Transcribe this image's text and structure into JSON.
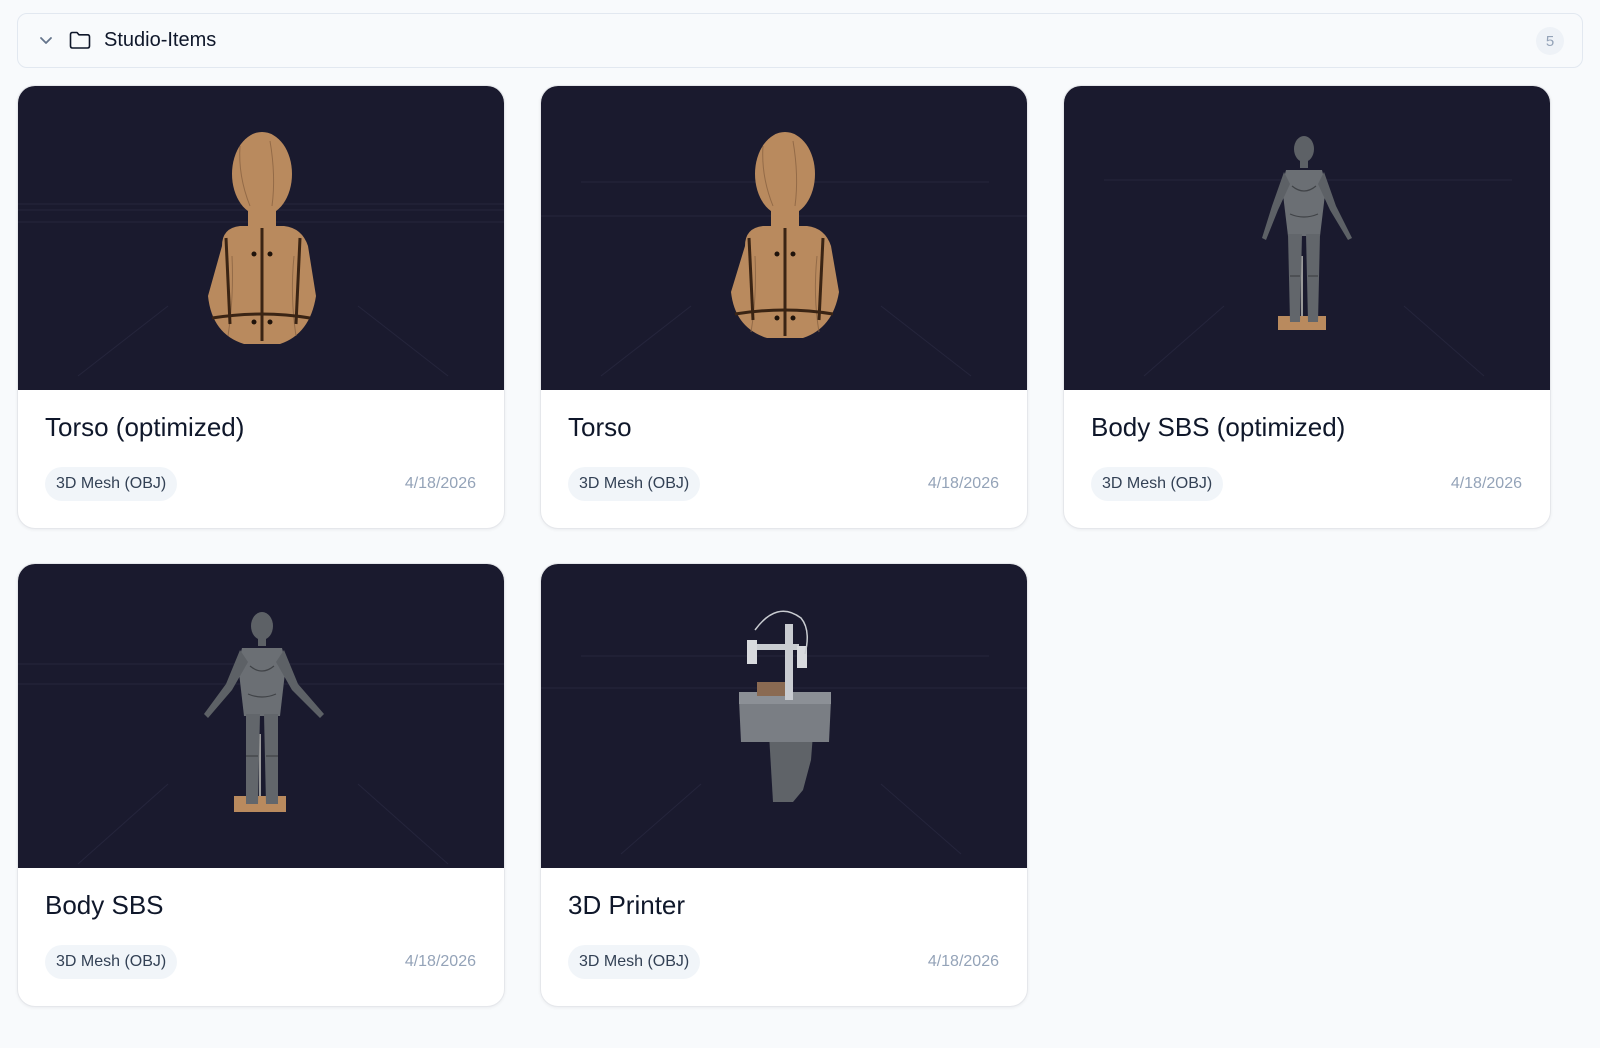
{
  "folder": {
    "name": "Studio-Items",
    "count": "5",
    "icons": {
      "toggle": "chevron-down-icon",
      "folder": "folder-icon"
    }
  },
  "items": [
    {
      "title": "Torso (optimized)",
      "type": "3D Mesh (OBJ)",
      "date": "4/18/2026",
      "model": "torso"
    },
    {
      "title": "Torso",
      "type": "3D Mesh (OBJ)",
      "date": "4/18/2026",
      "model": "torso"
    },
    {
      "title": "Body SBS (optimized)",
      "type": "3D Mesh (OBJ)",
      "date": "4/18/2026",
      "model": "body"
    },
    {
      "title": "Body SBS",
      "type": "3D Mesh (OBJ)",
      "date": "4/18/2026",
      "model": "body"
    },
    {
      "title": "3D Printer",
      "type": "3D Mesh (OBJ)",
      "date": "4/18/2026",
      "model": "printer"
    }
  ],
  "colors": {
    "thumbnail_bg": "#1a1a2e",
    "wood": "#b98a5e",
    "mesh_gray": "#6b6f74"
  }
}
